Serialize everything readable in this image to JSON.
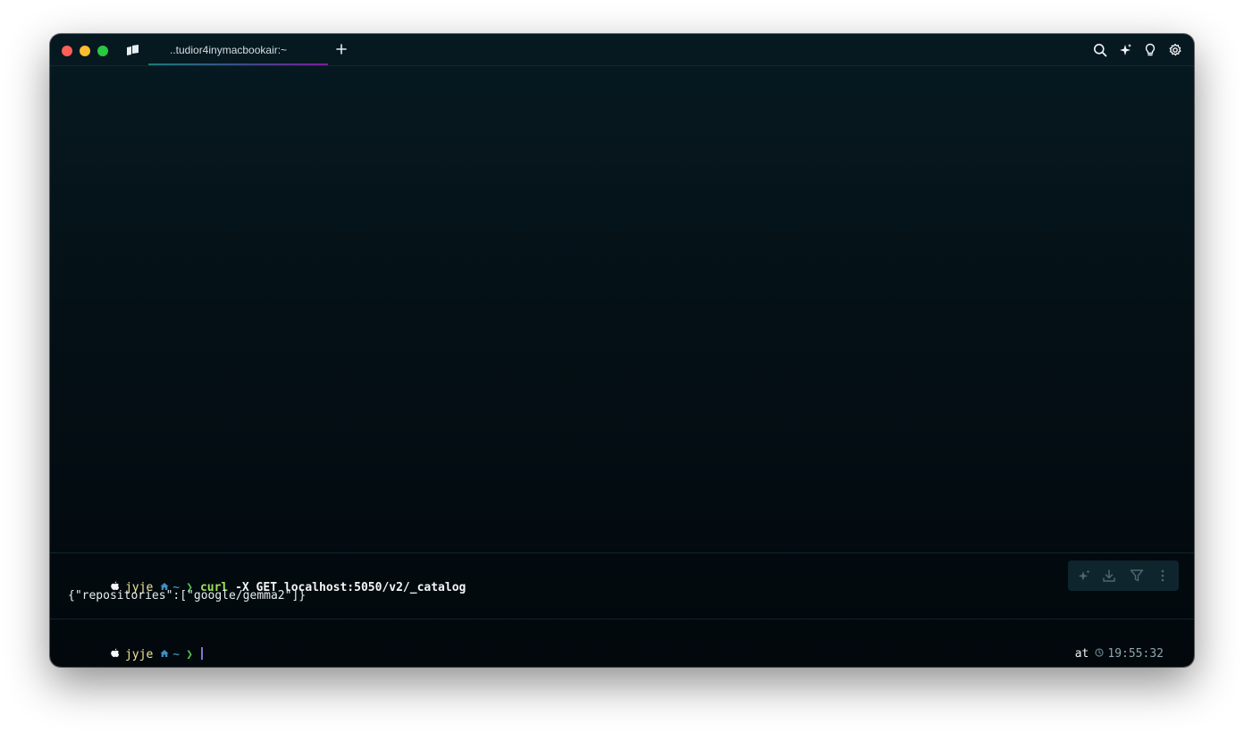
{
  "tab": {
    "title": "..tudior4inymacbookair:~"
  },
  "block": {
    "prompt": {
      "user": "jyje",
      "path": "~",
      "symbol": "❯"
    },
    "command": {
      "program": "curl",
      "args": "-X GET localhost:5050/v2/_catalog"
    },
    "output": "{\"repositories\":[\"google/gemma2\"]}"
  },
  "input_prompt": {
    "user": "jyje",
    "path": "~",
    "symbol": "❯"
  },
  "status": {
    "at_label": "at",
    "time": "19:55:32"
  },
  "colors": {
    "close": "#fe5f57",
    "minimize": "#febc2e",
    "maximize": "#28c840",
    "user": "#f2e69a",
    "path": "#4ea7d8",
    "chevron": "#4fc34f",
    "command": "#9fe15b"
  },
  "icons": {
    "titlebar_right": [
      "search-icon",
      "sparkle-icon",
      "lightbulb-icon",
      "gear-icon"
    ],
    "block_toolbar": [
      "ai-sparkle-icon",
      "download-icon",
      "filter-icon",
      "more-vertical-icon"
    ]
  }
}
